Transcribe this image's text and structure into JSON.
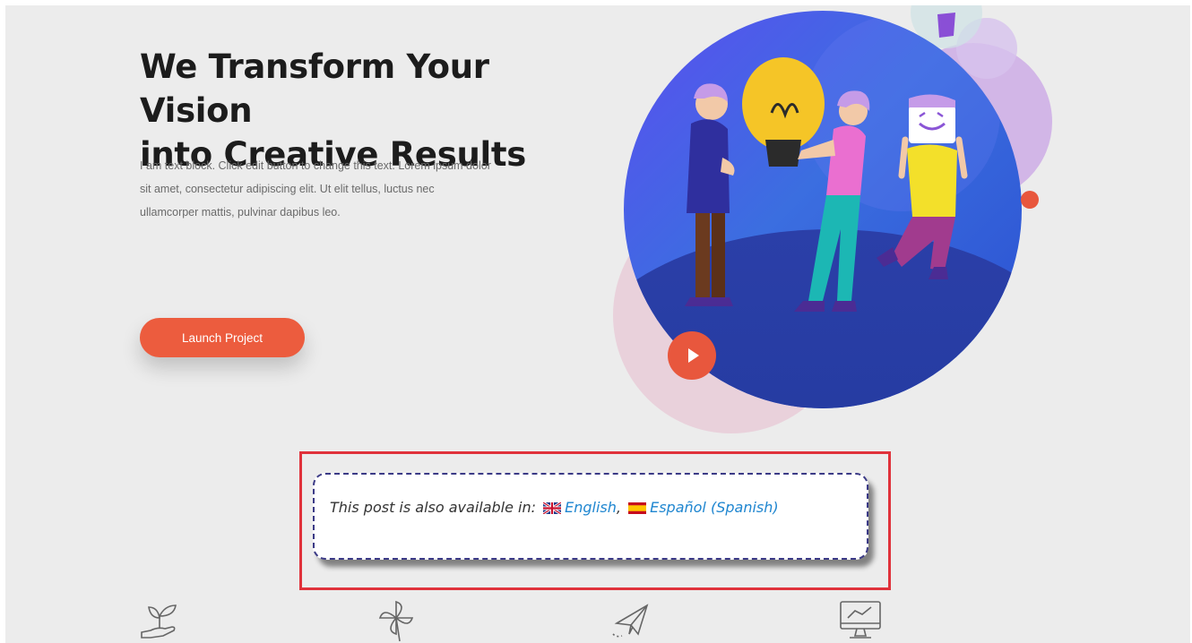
{
  "hero": {
    "title_line1": "We Transform Your Vision",
    "title_line2": "into Creative Results",
    "body_line1": "I am text block. Click edit button to change this text. Lorem ipsum dolor",
    "body_line2": "sit amet, consectetur adipiscing elit. Ut elit tellus, luctus nec",
    "body_line3": "ullamcorper mattis, pulvinar dapibus leo.",
    "cta_label": "Launch Project"
  },
  "language_notice": {
    "prefix": "This post is also available in:",
    "languages": [
      {
        "label": "English",
        "flag": "uk-flag-icon"
      },
      {
        "label": "Español (Spanish)",
        "flag": "spain-flag-icon"
      }
    ],
    "separator": ","
  },
  "features": {
    "icons": [
      "plant-in-hand-icon",
      "pinwheel-icon",
      "paper-plane-icon",
      "monitor-chart-icon"
    ]
  },
  "colors": {
    "accent": "#ec5c3e",
    "link": "#1f86d0",
    "highlight_border": "#e0323b",
    "illustration_blue": "#3d55d6",
    "dashed_border": "#3b3a86"
  }
}
